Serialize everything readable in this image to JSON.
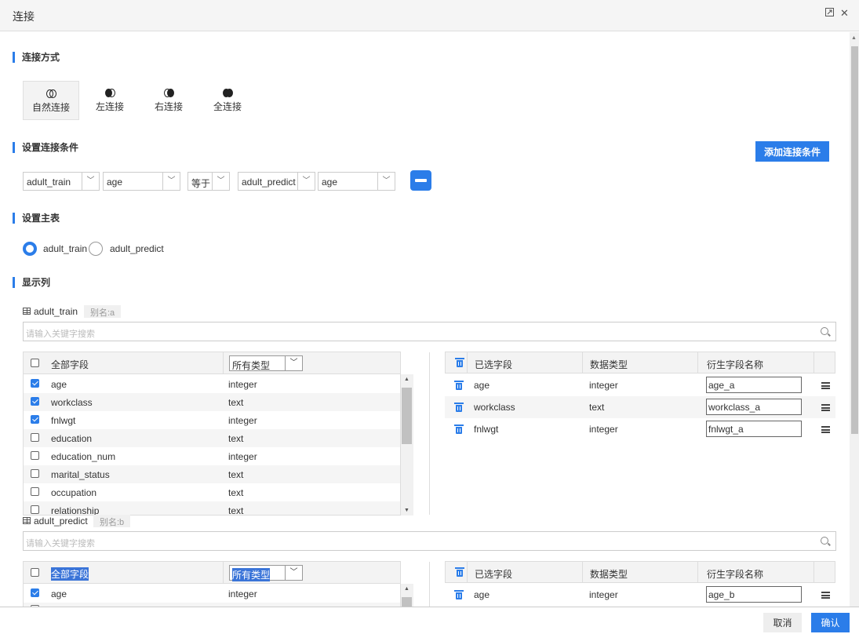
{
  "window": {
    "title": "连接",
    "restore_icon": "restore-icon",
    "close_glyph": "✕"
  },
  "join_method": {
    "section_title": "连接方式",
    "options": [
      {
        "label": "自然连接",
        "active": true
      },
      {
        "label": "左连接",
        "active": false
      },
      {
        "label": "右连接",
        "active": false
      },
      {
        "label": "全连接",
        "active": false
      }
    ]
  },
  "join_condition": {
    "section_title": "设置连接条件",
    "add_button": "添加连接条件",
    "left_table": "adult_train",
    "left_field": "age",
    "operator": "等于",
    "right_table": "adult_predict",
    "right_field": "age"
  },
  "main_table": {
    "section_title": "设置主表",
    "options": [
      {
        "label": "adult_train",
        "selected": true
      },
      {
        "label": "adult_predict",
        "selected": false
      }
    ]
  },
  "display_columns": {
    "section_title": "显示列",
    "tables": [
      {
        "name": "adult_train",
        "alias": "别名:a",
        "search_placeholder": "请输入关键字搜索",
        "header_all_fields": "全部字段",
        "header_type_filter": "所有类型",
        "fields": [
          {
            "name": "age",
            "type": "integer",
            "checked": true
          },
          {
            "name": "workclass",
            "type": "text",
            "checked": true
          },
          {
            "name": "fnlwgt",
            "type": "integer",
            "checked": true
          },
          {
            "name": "education",
            "type": "text",
            "checked": false
          },
          {
            "name": "education_num",
            "type": "integer",
            "checked": false
          },
          {
            "name": "marital_status",
            "type": "text",
            "checked": false
          },
          {
            "name": "occupation",
            "type": "text",
            "checked": false
          },
          {
            "name": "relationship",
            "type": "text",
            "checked": false
          }
        ],
        "selected_headers": {
          "selected": "已选字段",
          "datatype": "数据类型",
          "derived": "衍生字段名称"
        },
        "selected": [
          {
            "name": "age",
            "type": "integer",
            "derived": "age_a"
          },
          {
            "name": "workclass",
            "type": "text",
            "derived": "workclass_a"
          },
          {
            "name": "fnlwgt",
            "type": "integer",
            "derived": "fnlwgt_a"
          }
        ]
      },
      {
        "name": "adult_predict",
        "alias": "别名:b",
        "search_placeholder": "请输入关键字搜索",
        "header_all_fields": "全部字段",
        "header_type_filter": "所有类型",
        "fields": [
          {
            "name": "age",
            "type": "integer",
            "checked": true
          }
        ],
        "selected_headers": {
          "selected": "已选字段",
          "datatype": "数据类型",
          "derived": "衍生字段名称"
        },
        "selected": [
          {
            "name": "age",
            "type": "integer",
            "derived": "age_b"
          }
        ]
      }
    ]
  },
  "footer": {
    "cancel": "取消",
    "confirm": "确认"
  },
  "colors": {
    "accent": "#2b7de9",
    "header_bg": "#f5f5f5"
  }
}
